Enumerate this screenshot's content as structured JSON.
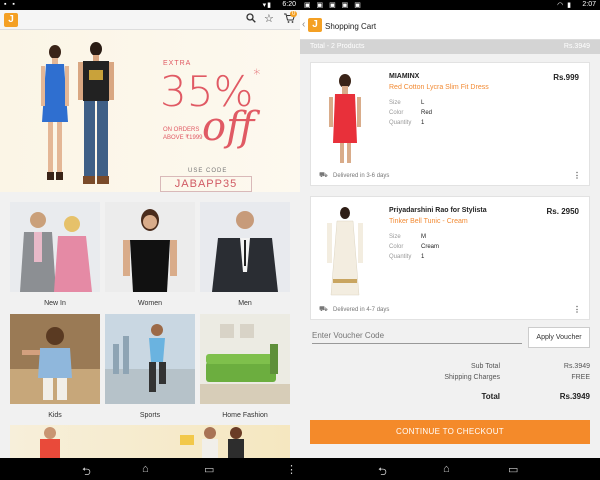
{
  "left": {
    "status": {
      "time": "6:20"
    },
    "appbar": {
      "logo": "J",
      "icons": [
        "search-icon",
        "star-icon",
        "cart-icon"
      ],
      "cart_count": "0"
    },
    "banner": {
      "extra": "EXTRA",
      "percent": "35%",
      "percent_mark": "*",
      "off": "off",
      "on_orders": "ON ORDERS ABOVE ₹1999",
      "use_code_label": "USE CODE",
      "code": "JABAPP35"
    },
    "categories": [
      {
        "label": "New In"
      },
      {
        "label": "Women"
      },
      {
        "label": "Men"
      },
      {
        "label": "Kids"
      },
      {
        "label": "Sports"
      },
      {
        "label": "Home Fashion"
      }
    ]
  },
  "right": {
    "status": {
      "time": "2:07"
    },
    "appbar": {
      "logo": "J",
      "title": "Shopping Cart"
    },
    "summary_bar": {
      "total_products": "Total - 2 Products",
      "total_amount": "Rs.3949"
    },
    "items": [
      {
        "brand": "MIAMINX",
        "name": "Red Cotton Lycra Slim Fit Dress",
        "price": "Rs.999",
        "attrs": [
          {
            "k": "Size",
            "v": "L"
          },
          {
            "k": "Color",
            "v": "Red"
          },
          {
            "k": "Quantity",
            "v": "1"
          }
        ],
        "delivery": "Delivered in 3-6 days"
      },
      {
        "brand": "Priyadarshini Rao for Stylista",
        "name": "Tinker Bell Tunic - Cream",
        "price": "Rs. 2950",
        "attrs": [
          {
            "k": "Size",
            "v": "M"
          },
          {
            "k": "Color",
            "v": "Cream"
          },
          {
            "k": "Quantity",
            "v": "1"
          }
        ],
        "delivery": "Delivered in 4-7 days"
      }
    ],
    "voucher": {
      "placeholder": "Enter Voucher Code",
      "button": "Apply Voucher"
    },
    "totals": {
      "sub_total_label": "Sub Total",
      "sub_total": "Rs.3949",
      "shipping_label": "Shipping Charges",
      "shipping": "FREE",
      "total_label": "Total",
      "total": "Rs.3949"
    },
    "checkout_label": "CONTINUE TO CHECKOUT"
  },
  "colors": {
    "brand_orange": "#f48a2a",
    "promo_pink": "#e05a64",
    "logo_yellow": "#f4a024"
  }
}
